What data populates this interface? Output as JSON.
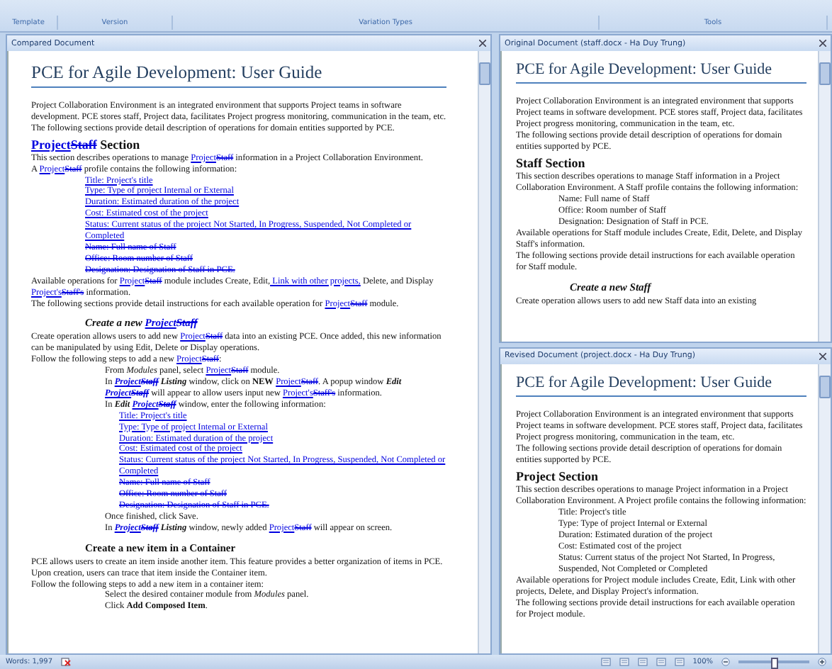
{
  "ribbon": {
    "groups": [
      "Template",
      "Version",
      "Variation Types",
      "Tools"
    ]
  },
  "compared": {
    "title": "Compared Document",
    "paragraphs": [
      {
        "kind": "title",
        "runs": [
          {
            "text": "PCE for Agile Development: User Guide"
          }
        ]
      },
      {
        "kind": "para",
        "runs": [
          {
            "text": "Project Collaboration Environment is an integrated environment that supports Project teams in software development. PCE stores staff, Project data, facilitates Project progress monitoring, communication in the team, etc."
          }
        ]
      },
      {
        "kind": "para",
        "runs": [
          {
            "text": "The following sections provide detail description of operations for domain entities supported by PCE."
          }
        ]
      },
      {
        "kind": "heading",
        "runs": [
          {
            "text": "Project",
            "kind": "inserted"
          },
          {
            "text": "Staff",
            "kind": "deleted"
          },
          {
            "text": " Section"
          }
        ]
      },
      {
        "kind": "para",
        "runs": [
          {
            "text": "This section describes operations to manage "
          },
          {
            "text": "Project",
            "kind": "inserted"
          },
          {
            "text": "Staff",
            "kind": "deleted"
          },
          {
            "text": " information in a Project Collaboration Environment."
          }
        ]
      },
      {
        "kind": "para",
        "runs": [
          {
            "text": "A "
          },
          {
            "text": "Project",
            "kind": "inserted"
          },
          {
            "text": "Staff",
            "kind": "deleted"
          },
          {
            "text": " profile contains the following information:"
          }
        ]
      },
      {
        "kind": "field",
        "runs": [
          {
            "text": "Title: Project's title",
            "kind": "inserted"
          }
        ]
      },
      {
        "kind": "field",
        "runs": [
          {
            "text": "Type: Type of project Internal or External",
            "kind": "inserted"
          }
        ]
      },
      {
        "kind": "field",
        "runs": [
          {
            "text": "Duration: Estimated duration of the project",
            "kind": "inserted"
          }
        ]
      },
      {
        "kind": "field",
        "runs": [
          {
            "text": "Cost: Estimated cost of the project",
            "kind": "inserted"
          }
        ]
      },
      {
        "kind": "field",
        "runs": [
          {
            "text": "Status: Current status of the project Not Started, In Progress, Suspended, Not Completed or Completed",
            "kind": "inserted"
          }
        ]
      },
      {
        "kind": "field",
        "runs": [
          {
            "text": "Name: Full name of Staff",
            "kind": "deleted"
          }
        ]
      },
      {
        "kind": "field",
        "runs": [
          {
            "text": "Office: Room number of Staff",
            "kind": "deleted"
          }
        ]
      },
      {
        "kind": "field",
        "runs": [
          {
            "text": "Designation: Designation of Staff in PCE.",
            "kind": "deleted"
          }
        ]
      },
      {
        "kind": "para",
        "runs": [
          {
            "text": "Available operations for "
          },
          {
            "text": "Project",
            "kind": "inserted"
          },
          {
            "text": "Staff",
            "kind": "deleted"
          },
          {
            "text": " module includes Create, Edit,"
          },
          {
            "text": " Link with other projects,",
            "kind": "inserted"
          },
          {
            "text": " Delete, and Display "
          },
          {
            "text": "Project's",
            "kind": "inserted"
          },
          {
            "text": "Staff's",
            "kind": "deleted"
          },
          {
            "text": " information."
          }
        ]
      },
      {
        "kind": "para",
        "runs": [
          {
            "text": "The following sections provide detail instructions for each available operation for "
          },
          {
            "text": "Project",
            "kind": "inserted"
          },
          {
            "text": "Staff",
            "kind": "deleted"
          },
          {
            "text": " module."
          }
        ]
      },
      {
        "kind": "subheading",
        "runs": [
          {
            "text": "Create a new "
          },
          {
            "text": "Project",
            "kind": "inserted"
          },
          {
            "text": "Staff",
            "kind": "deleted"
          }
        ]
      },
      {
        "kind": "para",
        "runs": [
          {
            "text": "Create operation allows users to add new "
          },
          {
            "text": "Project",
            "kind": "inserted"
          },
          {
            "text": "Staff",
            "kind": "deleted"
          },
          {
            "text": " data into an existing PCE. Once added, this new information can be manipulated by using Edit, Delete or Display operations."
          }
        ]
      },
      {
        "kind": "para",
        "runs": [
          {
            "text": "Follow the following steps to add a new "
          },
          {
            "text": "Project",
            "kind": "inserted"
          },
          {
            "text": "Staff",
            "kind": "deleted"
          },
          {
            "text": ":"
          }
        ]
      },
      {
        "kind": "step",
        "runs": [
          {
            "text": "From *Modules* panel, select "
          },
          {
            "text": "Project",
            "kind": "inserted"
          },
          {
            "text": "Staff",
            "kind": "deleted"
          },
          {
            "text": " module."
          }
        ]
      },
      {
        "kind": "step",
        "runs": [
          {
            "text": "In "
          },
          {
            "text": "Project",
            "kind": "inserted",
            "bold": true,
            "italic": true
          },
          {
            "text": "Staff",
            "kind": "deleted",
            "bold": true,
            "italic": true
          },
          {
            "text": " Listing",
            "bold": true,
            "italic": true
          },
          {
            "text": " window, click on **NEW** "
          },
          {
            "text": "Project",
            "kind": "inserted"
          },
          {
            "text": "Staff",
            "kind": "deleted"
          },
          {
            "text": ". A popup window "
          },
          {
            "text": "Edit ",
            "bold": true,
            "italic": true
          },
          {
            "text": "Project",
            "kind": "inserted",
            "bold": true,
            "italic": true
          },
          {
            "text": "Staff",
            "kind": "deleted",
            "bold": true,
            "italic": true
          },
          {
            "text": " will appear to allow users input new "
          },
          {
            "text": "Project's",
            "kind": "inserted"
          },
          {
            "text": "Staff's",
            "kind": "deleted"
          },
          {
            "text": " information."
          }
        ]
      },
      {
        "kind": "step",
        "runs": [
          {
            "text": "In "
          },
          {
            "text": "Edit ",
            "bold": true,
            "italic": true
          },
          {
            "text": "Project",
            "kind": "inserted",
            "bold": true,
            "italic": true
          },
          {
            "text": "Staff",
            "kind": "deleted",
            "bold": true,
            "italic": true
          },
          {
            "text": " window, enter the following information:"
          }
        ]
      },
      {
        "kind": "step_field",
        "runs": [
          {
            "text": "Title: Project's title",
            "kind": "inserted"
          }
        ]
      },
      {
        "kind": "step_field",
        "runs": [
          {
            "text": "Type: Type of project Internal or External",
            "kind": "inserted"
          }
        ]
      },
      {
        "kind": "step_field",
        "runs": [
          {
            "text": "Duration: Estimated duration of the project",
            "kind": "inserted"
          }
        ]
      },
      {
        "kind": "step_field",
        "runs": [
          {
            "text": "Cost: Estimated cost of the project",
            "kind": "inserted"
          }
        ]
      },
      {
        "kind": "step_field",
        "runs": [
          {
            "text": "Status: Current status of the project Not Started, In Progress, Suspended, Not Completed or Completed",
            "kind": "inserted"
          }
        ]
      },
      {
        "kind": "step_field",
        "runs": [
          {
            "text": "Name: Full name of Staff",
            "kind": "deleted"
          }
        ]
      },
      {
        "kind": "step_field",
        "runs": [
          {
            "text": "Office: Room number of Staff",
            "kind": "deleted"
          }
        ]
      },
      {
        "kind": "step_field",
        "runs": [
          {
            "text": "Designation: Designation of Staff in PCE.",
            "kind": "deleted"
          }
        ]
      },
      {
        "kind": "step",
        "runs": [
          {
            "text": "Once finished, click Save."
          }
        ]
      },
      {
        "kind": "step",
        "runs": [
          {
            "text": "In "
          },
          {
            "text": "Project",
            "kind": "inserted",
            "bold": true,
            "italic": true
          },
          {
            "text": "Staff",
            "kind": "deleted",
            "bold": true,
            "italic": true
          },
          {
            "text": " Listing",
            "bold": true,
            "italic": true
          },
          {
            "text": " window, newly added "
          },
          {
            "text": "Project",
            "kind": "inserted"
          },
          {
            "text": "Staff",
            "kind": "deleted"
          },
          {
            "text": " will appear on screen."
          }
        ]
      },
      {
        "kind": "subheading_plain",
        "runs": [
          {
            "text": "Create a new item in a Container"
          }
        ]
      },
      {
        "kind": "para",
        "runs": [
          {
            "text": "PCE allows users to create an item inside another item. This feature provides a better organization of items in PCE. Upon creation, users can trace that item inside the Container item."
          }
        ]
      },
      {
        "kind": "para",
        "runs": [
          {
            "text": "Follow the following steps to add a new item in a container item:"
          }
        ]
      },
      {
        "kind": "step",
        "runs": [
          {
            "text": "Select the desired container module from *Modules* panel."
          }
        ]
      },
      {
        "kind": "step",
        "runs": [
          {
            "text": "Click **Add Composed Item**."
          }
        ]
      }
    ]
  },
  "original": {
    "title": "Original Document (staff.docx - Ha Duy Trung)",
    "paragraphs": [
      {
        "kind": "title",
        "runs": [
          {
            "text": "PCE for Agile Development: User Guide"
          }
        ]
      },
      {
        "kind": "para",
        "runs": [
          {
            "text": "Project Collaboration Environment is an integrated environment that supports Project teams in software development. PCE stores staff, Project data, facilitates Project progress monitoring, communication in the team, etc."
          }
        ]
      },
      {
        "kind": "para",
        "runs": [
          {
            "text": "The following sections provide detail description of operations for domain entities supported by PCE."
          }
        ]
      },
      {
        "kind": "heading",
        "runs": [
          {
            "text": "Staff Section"
          }
        ]
      },
      {
        "kind": "para",
        "runs": [
          {
            "text": "This section describes operations to manage Staff information in a Project Collaboration Environment. A Staff profile contains the following information:"
          }
        ]
      },
      {
        "kind": "field",
        "runs": [
          {
            "text": "Name: Full name of Staff"
          }
        ]
      },
      {
        "kind": "field",
        "runs": [
          {
            "text": "Office: Room number of Staff"
          }
        ]
      },
      {
        "kind": "field",
        "runs": [
          {
            "text": "Designation: Designation of Staff in PCE."
          }
        ]
      },
      {
        "kind": "para",
        "runs": [
          {
            "text": "Available operations for Staff module includes Create, Edit, Delete, and Display Staff's information."
          }
        ]
      },
      {
        "kind": "para",
        "runs": [
          {
            "text": "The following sections provide detail instructions for each available operation for Staff module."
          }
        ]
      },
      {
        "kind": "subheading",
        "runs": [
          {
            "text": "Create a new Staff"
          }
        ]
      },
      {
        "kind": "para",
        "runs": [
          {
            "text": "Create operation allows users to add new Staff data into an existing"
          }
        ]
      }
    ]
  },
  "revised": {
    "title": "Revised Document (project.docx - Ha Duy Trung)",
    "paragraphs": [
      {
        "kind": "title",
        "runs": [
          {
            "text": "PCE for Agile Development: User Guide"
          }
        ]
      },
      {
        "kind": "para",
        "runs": [
          {
            "text": "Project Collaboration Environment is an integrated environment that supports Project teams in software development. PCE stores staff, Project data, facilitates Project progress monitoring, communication in the team, etc."
          }
        ]
      },
      {
        "kind": "para",
        "runs": [
          {
            "text": "The following sections provide detail description of operations for domain entities supported by PCE."
          }
        ]
      },
      {
        "kind": "heading",
        "runs": [
          {
            "text": "Project Section"
          }
        ]
      },
      {
        "kind": "para",
        "runs": [
          {
            "text": "This section describes operations to manage Project information in a Project Collaboration Environment. A Project profile contains the following information:"
          }
        ]
      },
      {
        "kind": "field",
        "runs": [
          {
            "text": "Title: Project's title"
          }
        ]
      },
      {
        "kind": "field",
        "runs": [
          {
            "text": "Type: Type of project Internal or External"
          }
        ]
      },
      {
        "kind": "field",
        "runs": [
          {
            "text": "Duration: Estimated duration of the project"
          }
        ]
      },
      {
        "kind": "field",
        "runs": [
          {
            "text": "Cost: Estimated cost of the project"
          }
        ]
      },
      {
        "kind": "field",
        "runs": [
          {
            "text": "Status: Current status of the project Not Started, In Progress, Suspended, Not Completed or Completed"
          }
        ]
      },
      {
        "kind": "para",
        "runs": [
          {
            "text": "Available operations for Project module includes Create, Edit, Link with other projects, Delete, and Display Project's information."
          }
        ]
      },
      {
        "kind": "para",
        "runs": [
          {
            "text": "The following sections provide detail instructions for each available operation for Project module."
          }
        ]
      }
    ]
  },
  "status_bar": {
    "words": "Words: 1,997",
    "zoom": {
      "reading": "100%",
      "level": 0.5
    }
  }
}
